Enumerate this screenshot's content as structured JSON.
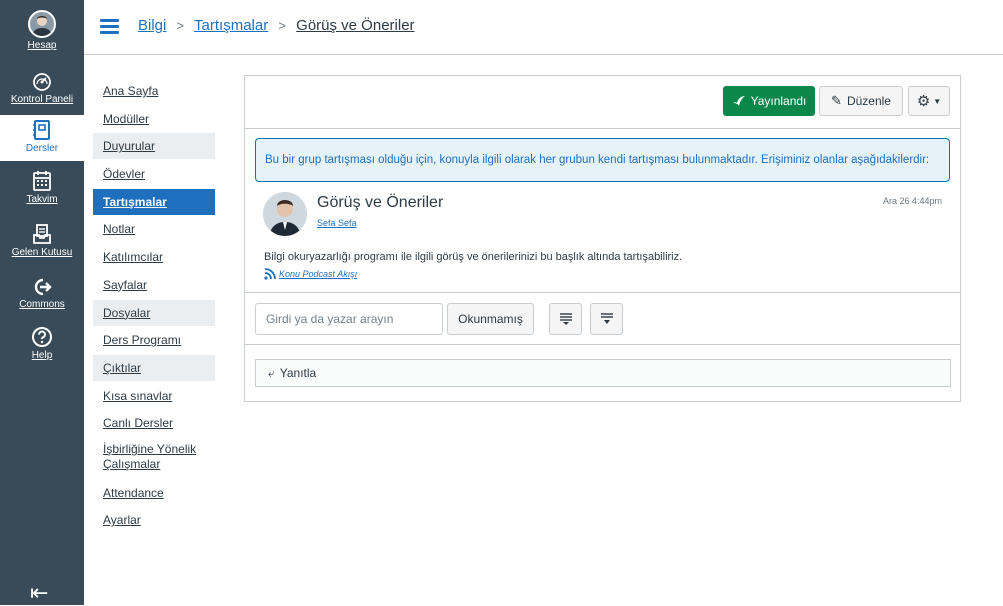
{
  "global_nav": {
    "account": "Hesap",
    "dashboard": "Kontrol Paneli",
    "courses": "Dersler",
    "calendar": "Takvim",
    "inbox": "Gelen Kutusu",
    "commons": "Commons",
    "help": "Help"
  },
  "breadcrumb": {
    "course": "Bilgi",
    "section": "Tartışmalar",
    "current": "Görüş ve Öneriler"
  },
  "course_nav": [
    "Ana Sayfa",
    "Modüller",
    "Duyurular",
    "Ödevler",
    "Tartışmalar",
    "Notlar",
    "Katılımcılar",
    "Sayfalar",
    "Dosyalar",
    "Ders Programı",
    "Çıktılar",
    "Kısa sınavlar",
    "Canlı Dersler",
    "İşbirliğine Yönelik Çalışmalar",
    "Attendance",
    "Ayarlar"
  ],
  "toolbar": {
    "published": "Yayınlandı",
    "edit": "Düzenle"
  },
  "info_message": "Bu bir grup tartışması olduğu için, konuyla ilgili olarak her grubun kendi tartışması bulunmaktadır. Erişiminiz olanlar aşağıdakilerdir:",
  "post": {
    "title": "Görüş ve Öneriler",
    "author": "Sefa Sefa",
    "date": "Ara 26 4:44pm",
    "body": "Bilgi okuryazarlığı programı ile ilgili görüş ve önerilerinizi bu başlık altında tartışabiliriz.",
    "podcast": "Konu Podcast Akışı"
  },
  "filters": {
    "search_placeholder": "Girdi ya da yazar arayın",
    "unread": "Okunmamış"
  },
  "reply": "Yanıtla",
  "colors": {
    "nav_bg": "#394b58",
    "accent": "#1f6fbf",
    "publish": "#0b874b"
  }
}
